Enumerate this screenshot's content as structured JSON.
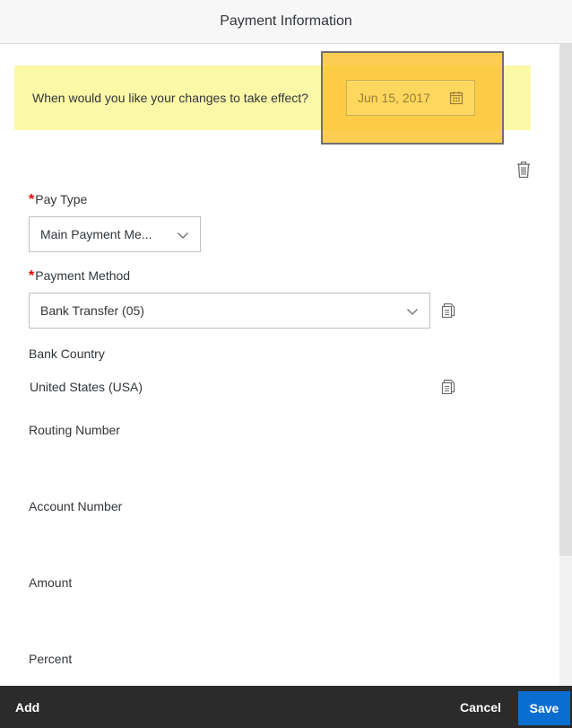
{
  "header": {
    "title": "Payment Information"
  },
  "effect": {
    "question": "When would you like your changes to take effect?",
    "date": "Jun 15, 2017"
  },
  "pay_type": {
    "required_mark": "*",
    "label": "Pay Type",
    "value": "Main Payment Me..."
  },
  "payment_method": {
    "required_mark": "*",
    "label": "Payment Method",
    "value": "Bank Transfer (05)"
  },
  "bank_country": {
    "label": "Bank Country",
    "value": "United States (USA)"
  },
  "routing_number": {
    "label": "Routing Number"
  },
  "account_number": {
    "label": "Account Number"
  },
  "amount": {
    "label": "Amount"
  },
  "percent": {
    "label": "Percent"
  },
  "footer": {
    "add_label": "Add",
    "cancel_label": "Cancel",
    "save_label": "Save"
  },
  "colors": {
    "accent": "#0a6ed1",
    "required": "#ee0000",
    "banner": "#fbf8a8",
    "highlight": "#fdc435",
    "footer_bg": "#2b2b2b"
  },
  "icons": {
    "calendar": "calendar-icon",
    "trash": "trash-icon",
    "chevron": "chevron-down-icon",
    "copy": "copy-icon"
  }
}
